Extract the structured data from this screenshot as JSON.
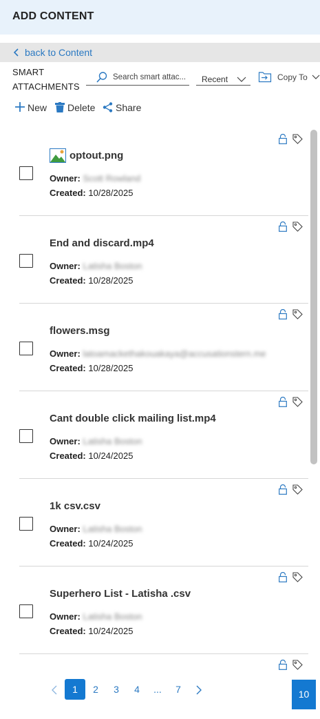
{
  "header": {
    "title": "ADD CONTENT"
  },
  "back": {
    "label": "back to Content"
  },
  "smart_attachments": {
    "title_line1": "SMART",
    "title_line2": "ATTACHMENTS",
    "search_placeholder": "Search smart attac...",
    "sort_value": "Recent",
    "copy_to_label": "Copy To"
  },
  "toolbar": {
    "new_label": "New",
    "delete_label": "Delete",
    "share_label": "Share"
  },
  "labels": {
    "owner": "Owner:",
    "created": "Created:"
  },
  "items": [
    {
      "name": "optout.png",
      "owner": "Scott Rowland",
      "created": "10/28/2025",
      "icon": "image-file-icon"
    },
    {
      "name": "End and discard.mp4",
      "owner": "Latisha Boston",
      "created": "10/28/2025"
    },
    {
      "name": "flowers.msg",
      "owner": "latoamackethakouakaya@accusationstern.me",
      "created": "10/28/2025"
    },
    {
      "name": "Cant double click mailing list.mp4",
      "owner": "Latisha Boston",
      "created": "10/24/2025"
    },
    {
      "name": "1k csv.csv",
      "owner": "Latisha Boston",
      "created": "10/24/2025"
    },
    {
      "name": "Superhero List - Latisha .csv",
      "owner": "Latisha Boston",
      "created": "10/24/2025"
    }
  ],
  "pagination": {
    "pages": [
      "1",
      "2",
      "3",
      "4",
      "...",
      "7"
    ],
    "current": "1",
    "page_size": "10"
  },
  "colors": {
    "accent": "#1479d1",
    "link": "#2b79c2",
    "header_bg": "#e8f2fb"
  }
}
